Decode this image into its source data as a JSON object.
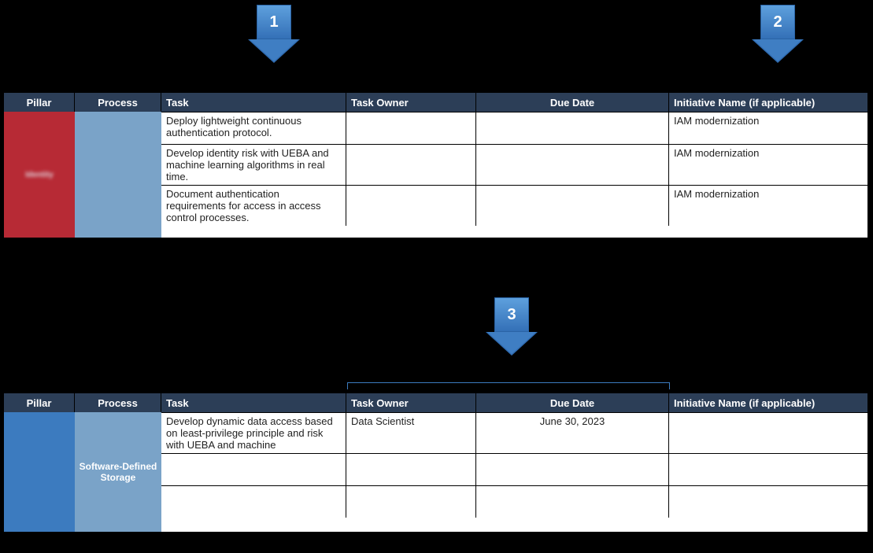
{
  "arrows": {
    "a1": {
      "label": "1"
    },
    "a2": {
      "label": "2"
    },
    "a3": {
      "label": "3"
    }
  },
  "headers": {
    "pillar": "Pillar",
    "process": "Process",
    "task": "Task",
    "owner": "Task Owner",
    "due": "Due Date",
    "initiative": "Initiative Name (if applicable)"
  },
  "table1": {
    "pillar": "Identity",
    "process": "",
    "rows": [
      {
        "task": "Deploy lightweight continuous authentication protocol.",
        "owner": "",
        "due": "",
        "initiative": "IAM modernization"
      },
      {
        "task": "Develop identity risk with UEBA and machine learning algorithms in real time.",
        "owner": "",
        "due": "",
        "initiative": "IAM modernization"
      },
      {
        "task": "Document authentication requirements for access in access control processes.",
        "owner": "",
        "due": "",
        "initiative": "IAM modernization"
      }
    ]
  },
  "table2": {
    "pillar": "",
    "process": "Software-Defined Storage",
    "rows": [
      {
        "task": "Develop dynamic data access based on least-privilege principle and risk with UEBA and machine",
        "owner": "Data Scientist",
        "due": "June 30, 2023",
        "initiative": ""
      },
      {
        "task": "",
        "owner": "",
        "due": "",
        "initiative": ""
      },
      {
        "task": "",
        "owner": "",
        "due": "",
        "initiative": ""
      }
    ]
  }
}
